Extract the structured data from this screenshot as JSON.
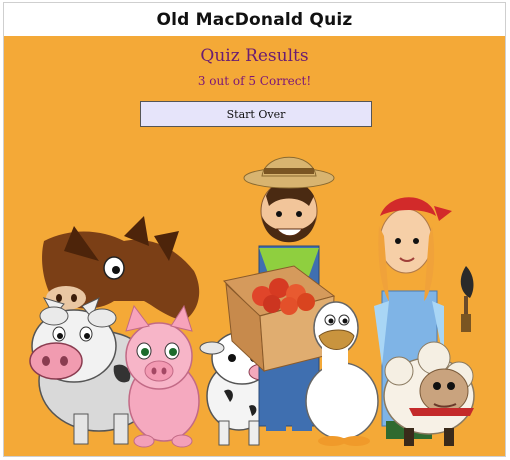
{
  "app": {
    "title": "Old MacDonald Quiz"
  },
  "results": {
    "heading": "Quiz Results",
    "score_text": "3 out of 5 Correct!",
    "correct": 3,
    "total": 5
  },
  "actions": {
    "start_over_label": "Start Over"
  },
  "illustration": {
    "subjects": [
      "horse",
      "cow",
      "pig",
      "calf",
      "farmer",
      "crate of apples",
      "duck",
      "farm girl",
      "trowel",
      "sheep"
    ]
  },
  "colors": {
    "background": "#f4a937",
    "heading": "#6a1d72",
    "score": "#7a1578",
    "button_bg": "#e6e4fa"
  }
}
